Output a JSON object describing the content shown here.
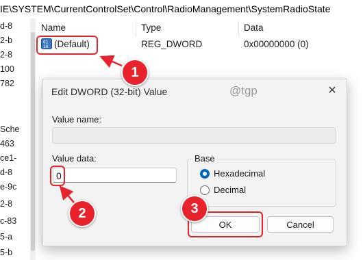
{
  "address_bar": {
    "path": "IE\\SYSTEM\\CurrentControlSet\\Control\\RadioManagement\\SystemRadioState"
  },
  "tree": {
    "items": [
      "d-8",
      "2-b",
      "2-8",
      "100",
      "782",
      "Sche",
      "463",
      "ce1-",
      "d-8",
      "e-9c",
      "2-8",
      "c-83",
      "5-a",
      "5-b"
    ]
  },
  "list": {
    "columns": {
      "name": "Name",
      "type": "Type",
      "data": "Data"
    },
    "rows": [
      {
        "name": "(Default)",
        "type": "REG_DWORD",
        "data": "0x00000000 (0)"
      }
    ]
  },
  "dialog": {
    "title": "Edit DWORD (32-bit) Value",
    "close_glyph": "✕",
    "watermark": "@tgp",
    "value_name_label": "Value name:",
    "value_name": "",
    "value_data_label": "Value data:",
    "value_data": "0",
    "base_label": "Base",
    "base_options": [
      "Hexadecimal",
      "Decimal"
    ],
    "base_selected": "Hexadecimal",
    "ok_label": "OK",
    "cancel_label": "Cancel"
  },
  "annotations": {
    "steps": [
      "1",
      "2",
      "3"
    ],
    "color": "#e8232b"
  },
  "colors": {
    "accent": "#0067c0",
    "dialog_bg": "#f3f3f3"
  },
  "icons": {
    "registry_value": "registry-dword-icon",
    "close": "close-icon"
  }
}
